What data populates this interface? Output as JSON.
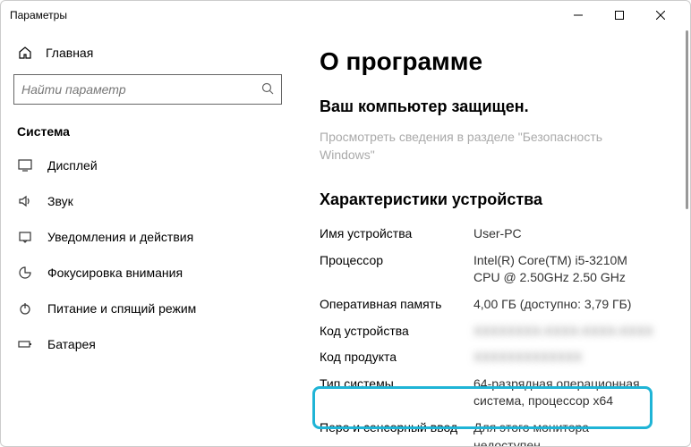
{
  "titlebar": {
    "title": "Параметры"
  },
  "sidebar": {
    "home_label": "Главная",
    "search_placeholder": "Найти параметр",
    "section_label": "Система",
    "items": [
      {
        "label": "Дисплей"
      },
      {
        "label": "Звук"
      },
      {
        "label": "Уведомления и действия"
      },
      {
        "label": "Фокусировка внимания"
      },
      {
        "label": "Питание и спящий режим"
      },
      {
        "label": "Батарея"
      }
    ]
  },
  "main": {
    "title": "О программе",
    "protected_label": "Ваш компьютер защищен.",
    "security_link": "Просмотреть сведения в разделе \"Безопасность Windows\"",
    "specs_header": "Характеристики устройства",
    "specs": {
      "device_name_k": "Имя устройства",
      "device_name_v": "User-PC",
      "processor_k": "Процессор",
      "processor_v": "Intel(R) Core(TM) i5-3210M CPU @ 2.50GHz   2.50 GHz",
      "ram_k": "Оперативная память",
      "ram_v": "4,00 ГБ (доступно: 3,79 ГБ)",
      "device_id_k": "Код устройства",
      "device_id_v": "XXXXXXXX-XXXX-XXXX-XXXX",
      "product_id_k": "Код продукта",
      "product_id_v": "XXXXXXXXXXXXX",
      "system_type_k": "Тип системы",
      "system_type_v": "64-разрядная операционная система, процессор x64",
      "pen_k": "Перо и сенсорный ввод",
      "pen_v": "Для этого монитора недоступен"
    }
  }
}
